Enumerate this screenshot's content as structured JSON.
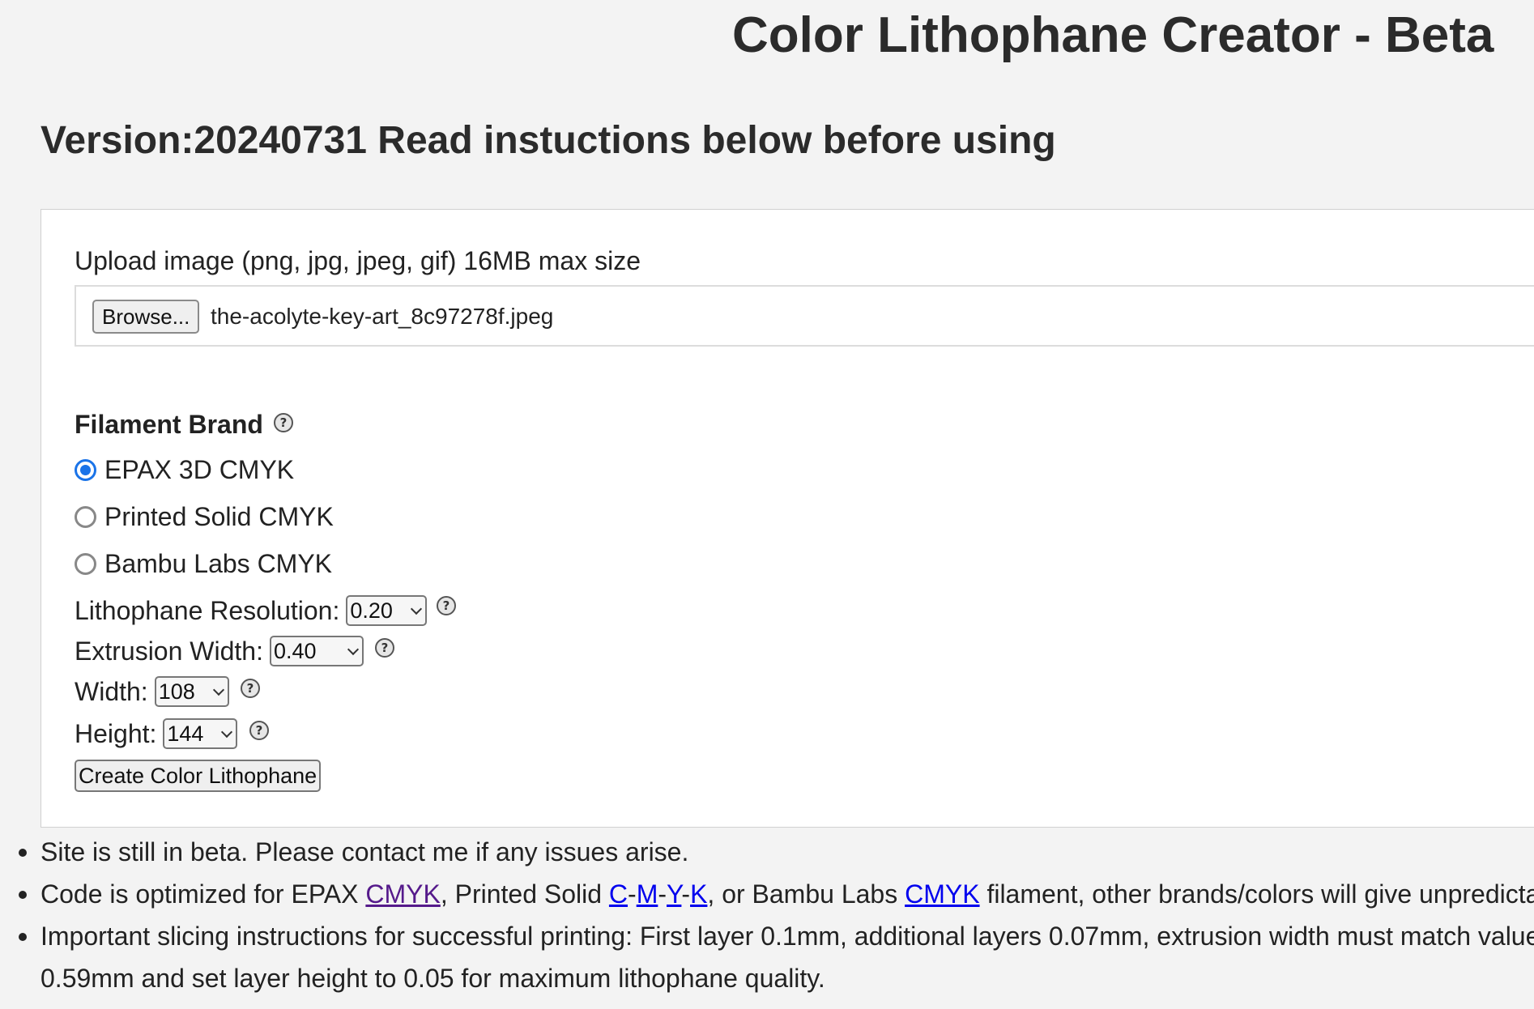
{
  "header": {
    "title": "Color Lithophane Creator - Beta",
    "version_line": "Version:20240731 Read instuctions below before using"
  },
  "upload": {
    "label": "Upload image (png, jpg, jpeg, gif) 16MB max size",
    "browse_label": "Browse...",
    "file_name": "the-acolyte-key-art_8c97278f.jpeg"
  },
  "filament": {
    "heading": "Filament Brand",
    "help_glyph": "?",
    "options": [
      {
        "label": "EPAX 3D CMYK",
        "checked": true
      },
      {
        "label": "Printed Solid CMYK",
        "checked": false
      },
      {
        "label": "Bambu Labs CMYK",
        "checked": false
      }
    ]
  },
  "settings": {
    "resolution": {
      "label": "Lithophane Resolution:",
      "value": "0.20"
    },
    "extrusion_width": {
      "label": "Extrusion Width:",
      "value": "0.40"
    },
    "width": {
      "label": "Width:",
      "value": "108"
    },
    "height": {
      "label": "Height:",
      "value": "144"
    }
  },
  "create_button": "Create Color Lithophane",
  "notes": {
    "note1": "Site is still in beta. Please contact me if any issues arise.",
    "note2": {
      "prefix": "Code is optimized for EPAX ",
      "link_cmyk_1": "CMYK",
      "mid1": ", Printed Solid ",
      "link_c": "C",
      "dash": "-",
      "link_m": "M",
      "link_y": "Y",
      "link_k": "K",
      "mid2": ", or Bambu Labs ",
      "link_cmyk_2": "CMYK",
      "suffix": " filament, other brands/colors will give unpredicta"
    },
    "note3_line1": "Important slicing instructions for successful printing: First layer 0.1mm, additional layers 0.07mm, extrusion width must match value",
    "note3_line2": "0.59mm and set layer height to 0.05 for maximum lithophane quality."
  },
  "colors": {
    "radio_selected": "#1a73e8",
    "link": "#0000ee",
    "link_visited": "#551a8b",
    "background": "#f3f3f3"
  }
}
